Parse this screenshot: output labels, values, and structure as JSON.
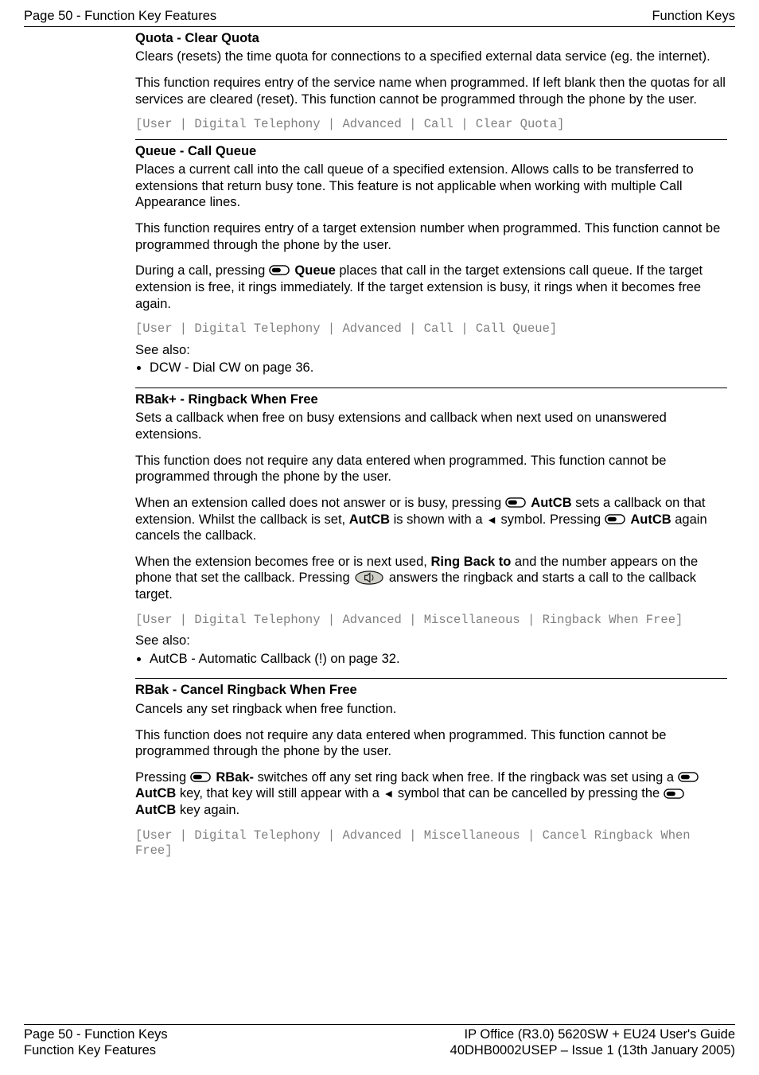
{
  "header": {
    "left": "Page 50 - Function Key Features",
    "right": "Function Keys"
  },
  "quota": {
    "title": "Quota - Clear Quota",
    "p1": "Clears (resets) the time quota for connections to a specified external data service (eg. the internet).",
    "p2": "This function requires entry of the service name when programmed. If left blank then the quotas for all services are cleared (reset). This function cannot be programmed through the phone by the user.",
    "code": "[User | Digital Telephony | Advanced | Call | Clear Quota]"
  },
  "queue": {
    "title": "Queue - Call Queue",
    "p1": "Places a current call into the call queue of a specified extension. Allows calls to be transferred to extensions that return busy tone. This feature is not applicable when working with multiple Call Appearance lines.",
    "p2": "This function requires entry of a target extension number when programmed. This function cannot be programmed through the phone by the user.",
    "p3_a": "During a call, pressing ",
    "p3_bold": "Queue",
    "p3_b": " places that call in the target extensions call queue. If the target extension is free, it rings immediately. If the target extension is busy, it rings when it becomes free again.",
    "code": "[User | Digital Telephony | Advanced | Call | Call Queue]",
    "see_also": "See also:",
    "see_items": [
      "DCW - Dial CW on page 36."
    ]
  },
  "rbakplus": {
    "title": "RBak+ - Ringback When Free",
    "p1": "Sets a callback when free on busy extensions and callback when next used on unanswered extensions.",
    "p2": "This function does not require any data entered when programmed. This function cannot be programmed through the phone by the user.",
    "p3_a": "When an extension called does not answer or is busy, pressing ",
    "p3_bold1": "AutCB",
    "p3_b": " sets a callback on that extension. Whilst the callback is set, ",
    "p3_bold2": "AutCB",
    "p3_c": " is shown with a ",
    "p3_d": " symbol. Pressing ",
    "p3_bold3": "AutCB",
    "p3_e": " again cancels the callback.",
    "p4_a": "When the extension becomes free or is next used, ",
    "p4_bold": "Ring Back to",
    "p4_b": " and the number appears on the phone that set the callback. Pressing ",
    "p4_c": " answers the ringback and starts a call to the callback target.",
    "code": "[User | Digital Telephony | Advanced | Miscellaneous | Ringback When Free]",
    "see_also": "See also:",
    "see_items": [
      "AutCB - Automatic Callback (!) on page 32."
    ]
  },
  "rbak": {
    "title": "RBak - Cancel Ringback When Free",
    "p1": "Cancels any set ringback when free function.",
    "p2": "This function does not require any data entered when programmed. This function cannot be programmed through the phone by the user.",
    "p3_a": "Pressing ",
    "p3_bold1": "RBak-",
    "p3_b": " switches off any set ring back when free. If the ringback was set using a ",
    "p3_bold2": "AutCB",
    "p3_c": " key, that key will still appear with a ",
    "p3_d": " symbol that can be cancelled by pressing the ",
    "p3_bold3": "AutCB",
    "p3_e": " key again.",
    "code": "[User | Digital Telephony | Advanced | Miscellaneous | Cancel Ringback When Free]"
  },
  "footer": {
    "left1": "Page 50 - Function Keys",
    "left2": "Function Key Features",
    "right1": "IP Office (R3.0) 5620SW + EU24 User's Guide",
    "right2": "40DHB0002USEP – Issue 1 (13th January 2005)"
  }
}
